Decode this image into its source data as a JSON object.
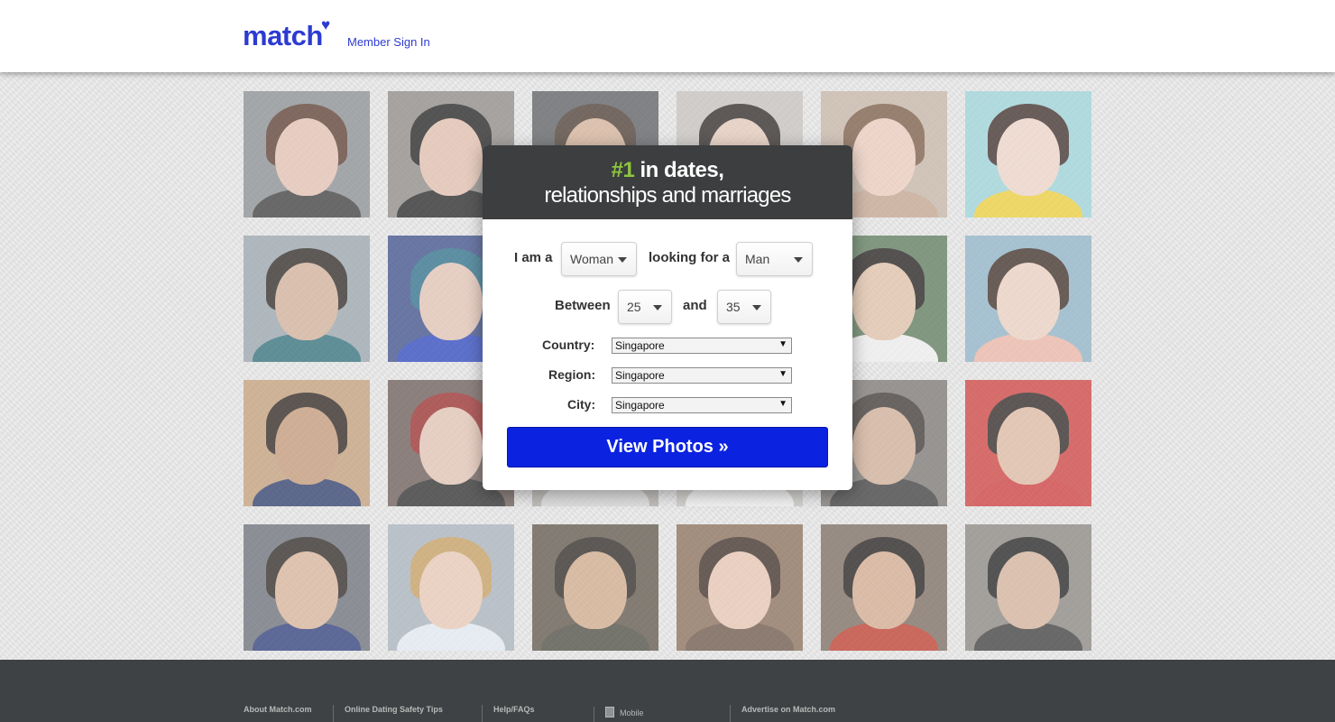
{
  "header": {
    "logo_text": "match",
    "logo_heart": "♥",
    "signin_label": "Member Sign In",
    "brand_color": "#2d3bd1"
  },
  "photos": [
    {
      "bg": "#8a8f93",
      "skin": "#e8c4b4",
      "hair": "#5a3a2e",
      "shirt": "#3a3a3a"
    },
    {
      "bg": "#8e8a86",
      "skin": "#e6c2b0",
      "hair": "#1e1e1e",
      "shirt": "#222222"
    },
    {
      "bg": "#5a5d60",
      "skin": "#d8b49a",
      "hair": "#4a3a30",
      "shirt": "#2a2a2a"
    },
    {
      "bg": "#c8c4c0",
      "skin": "#e8cdbd",
      "hair": "#2a2422",
      "shirt": "#dddddd"
    },
    {
      "bg": "#c9b7a8",
      "skin": "#f0cfc0",
      "hair": "#7a5a44",
      "shirt": "#c7a690"
    },
    {
      "bg": "#9ed6dc",
      "skin": "#f2d8cc",
      "hair": "#3a2a26",
      "shirt": "#f2d23a"
    },
    {
      "bg": "#9aa6ae",
      "skin": "#d6b29a",
      "hair": "#2a2420",
      "shirt": "#2e6e7a"
    },
    {
      "bg": "#3b4d8a",
      "skin": "#e6c6b6",
      "hair": "#2a6e8a",
      "shirt": "#2a45c0"
    },
    {
      "bg": "#a6a19a",
      "skin": "#e0c2ac",
      "hair": "#3a302a",
      "shirt": "#e5e5e5"
    },
    {
      "bg": "#b0aba6",
      "skin": "#e8ccbc",
      "hair": "#2a2220",
      "shirt": "#4a4a4a"
    },
    {
      "bg": "#5c7a5a",
      "skin": "#e4c4aa",
      "hair": "#1e1a18",
      "shirt": "#f2f2f2"
    },
    {
      "bg": "#8fb4c8",
      "skin": "#f0d4c4",
      "hair": "#3a2a22",
      "shirt": "#f0b8a8"
    },
    {
      "bg": "#c6a07a",
      "skin": "#c69a78",
      "hair": "#2a201a",
      "shirt": "#2a3a6a"
    },
    {
      "bg": "#6a5a56",
      "skin": "#e6c6b6",
      "hair": "#9a2a2a",
      "shirt": "#2a2a2a"
    },
    {
      "bg": "#b0ada8",
      "skin": "#e0c4b0",
      "hair": "#2a2420",
      "shirt": "#d8d8d8"
    },
    {
      "bg": "#c8c6c2",
      "skin": "#e6cab8",
      "hair": "#2a2420",
      "shirt": "#f4f4f4"
    },
    {
      "bg": "#7a7672",
      "skin": "#d4b098",
      "hair": "#3a3430",
      "shirt": "#3a3a3a"
    },
    {
      "bg": "#d0403e",
      "skin": "#e2bca4",
      "hair": "#2a2220",
      "shirt": "#d03a3a"
    },
    {
      "bg": "#6a6e78",
      "skin": "#dcb69c",
      "hair": "#2a2420",
      "shirt": "#2a3a7a"
    },
    {
      "bg": "#aab4be",
      "skin": "#ecccb8",
      "hair": "#c8a060",
      "shirt": "#e6eef6"
    },
    {
      "bg": "#5e5448",
      "skin": "#d4ac8c",
      "hair": "#2a2420",
      "shirt": "#4a4a40"
    },
    {
      "bg": "#8a6e58",
      "skin": "#ecc8b4",
      "hair": "#3a2a22",
      "shirt": "#6a5446"
    },
    {
      "bg": "#7a6a5e",
      "skin": "#d6ac90",
      "hair": "#1e1a18",
      "shirt": "#c03a2a"
    },
    {
      "bg": "#8a8680",
      "skin": "#d8b49c",
      "hair": "#1e1e1e",
      "shirt": "#3a3a3a"
    }
  ],
  "modal": {
    "headline_num": "#1",
    "headline_rest": " in dates,",
    "subline": "relationships and marriages",
    "i_am_label": "I am a",
    "i_am_value": "Woman",
    "looking_label": "looking for a",
    "looking_value": "Man",
    "between_label": "Between",
    "age_min": "25",
    "and_label": "and",
    "age_max": "35",
    "country_label": "Country:",
    "country_value": "Singapore",
    "region_label": "Region:",
    "region_value": "Singapore",
    "city_label": "City:",
    "city_value": "Singapore",
    "cta_label": "View Photos »",
    "accent_green": "#8dc63f",
    "button_color": "#0b22e0"
  },
  "footer": {
    "col1": "About Match.com",
    "col2": "Online Dating Safety Tips",
    "col3": "Help/FAQs",
    "col4": "Mobile",
    "col5": "Advertise on Match.com"
  }
}
